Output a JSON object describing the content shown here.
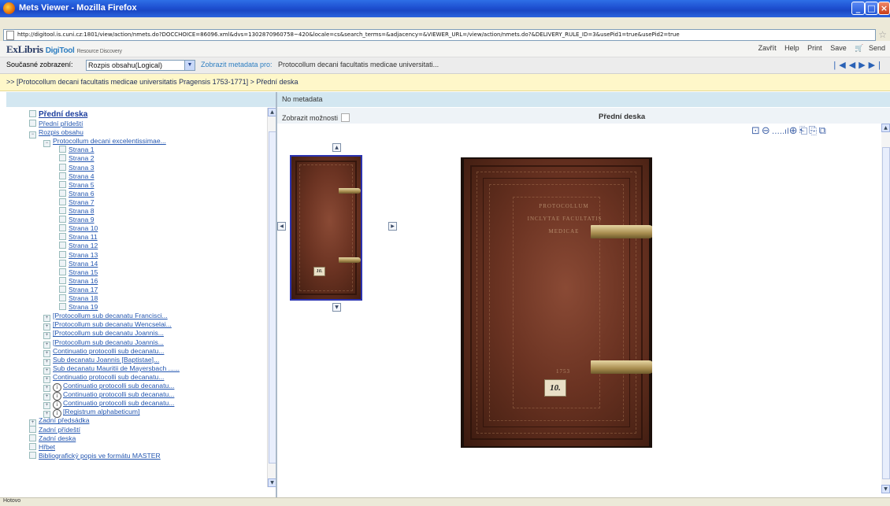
{
  "window": {
    "title": "Mets Viewer - Mozilla Firefox"
  },
  "browser": {
    "url": "http://digitool.is.cuni.cz:1801/view/action/nmets.do?DOCCHOICE=86096.xml&dvs=1302870960758~420&locale=cs&search_terms=&adjacency=&VIEWER_URL=/view/action/nmets.do?&DELIVERY_RULE_ID=3&usePid1=true&usePid2=true",
    "status": "Hotovo"
  },
  "header": {
    "logo_main": "ExLibris",
    "logo_product": "DigiTool",
    "logo_sub": "Resource Discovery",
    "menu": [
      "Zavřít",
      "Help",
      "Print",
      "Save",
      "Send"
    ]
  },
  "viewbar": {
    "current_view_label": "Současné zobrazení:",
    "current_view_value": "Rozpis obsahu(Logical)",
    "metadata_label": "Zobrazit metadata pro:",
    "metadata_value": "Protocollum decani facultatis medicae universitati..."
  },
  "breadcrumb": ">> [Protocollum decani facultatis medicae universitatis Pragensis 1753-1771] > Přední deska",
  "viewer": {
    "no_metadata": "No metadata",
    "options_label": "Zobrazit možnosti",
    "page_title": "Přední deska"
  },
  "tree": [
    {
      "label": "Přední deska",
      "level": 1,
      "active": true
    },
    {
      "label": "Přední přídeští",
      "level": 1
    },
    {
      "label": "Rozpis obsahu",
      "level": 1,
      "expander": "⊟"
    },
    {
      "label": "Protocollum decani excelentissimae...",
      "level": 2,
      "expander": "⊟"
    },
    {
      "label": "Strana 1",
      "level": 3
    },
    {
      "label": "Strana 2",
      "level": 3
    },
    {
      "label": "Strana 3",
      "level": 3
    },
    {
      "label": "Strana 4",
      "level": 3
    },
    {
      "label": "Strana 5",
      "level": 3
    },
    {
      "label": "Strana 6",
      "level": 3
    },
    {
      "label": "Strana 7",
      "level": 3
    },
    {
      "label": "Strana 8",
      "level": 3
    },
    {
      "label": "Strana 9",
      "level": 3
    },
    {
      "label": "Strana 10",
      "level": 3
    },
    {
      "label": "Strana 11",
      "level": 3
    },
    {
      "label": "Strana 12",
      "level": 3
    },
    {
      "label": "Strana 13",
      "level": 3
    },
    {
      "label": "Strana 14",
      "level": 3
    },
    {
      "label": "Strana 15",
      "level": 3
    },
    {
      "label": "Strana 16",
      "level": 3
    },
    {
      "label": "Strana 17",
      "level": 3
    },
    {
      "label": "Strana 18",
      "level": 3
    },
    {
      "label": "Strana 19",
      "level": 3
    },
    {
      "label": "[Protocollum sub decanatu Francisci...",
      "level": 2,
      "expander": "⊞"
    },
    {
      "label": "[Protocollum sub decanatu Wencselai...",
      "level": 2,
      "expander": "⊞"
    },
    {
      "label": "[Protocollum sub decanatu Joannis...",
      "level": 2,
      "expander": "⊞"
    },
    {
      "label": "[Protocollum sub decanatu Joannis...",
      "level": 2,
      "expander": "⊞"
    },
    {
      "label": "Continuatio protocolli sub decanatu...",
      "level": 2,
      "expander": "⊞"
    },
    {
      "label": "Sub decanatu Joannis [Baptistae]...",
      "level": 2,
      "expander": "⊞"
    },
    {
      "label": "Sub decanatu Mauritii de Mayersbach ......",
      "level": 2,
      "expander": "⊞"
    },
    {
      "label": "Continuatio protocolli sub decanatu...",
      "level": 2,
      "expander": "⊞"
    },
    {
      "label": "Continuatio protocolli sub decanatu...",
      "level": 2,
      "expander": "⊞",
      "info": true
    },
    {
      "label": "Continuatio protocolli sub decanatu...",
      "level": 2,
      "expander": "⊞",
      "info": true
    },
    {
      "label": "Continuatio protocolli sub decanatu...",
      "level": 2,
      "expander": "⊞",
      "info": true
    },
    {
      "label": "[Registrum alphabeticum]",
      "level": 2,
      "expander": "⊞",
      "info": true
    },
    {
      "label": "Zadní předsádka",
      "level": 1,
      "expander": "⊞"
    },
    {
      "label": "Zadní přídeští",
      "level": 1
    },
    {
      "label": "Zadní deska",
      "level": 1
    },
    {
      "label": "Hřbet",
      "level": 1
    },
    {
      "label": "Bibliografický popis ve formátu MASTER",
      "level": 1
    }
  ],
  "cover": {
    "label_number": "10.",
    "spine_text_1": "PROTOCOLLUM",
    "spine_text_2": "INCLYTAE FACULTATIS",
    "spine_text_3": "MEDICAE",
    "year": "1753"
  },
  "icons": {
    "info": "i"
  }
}
